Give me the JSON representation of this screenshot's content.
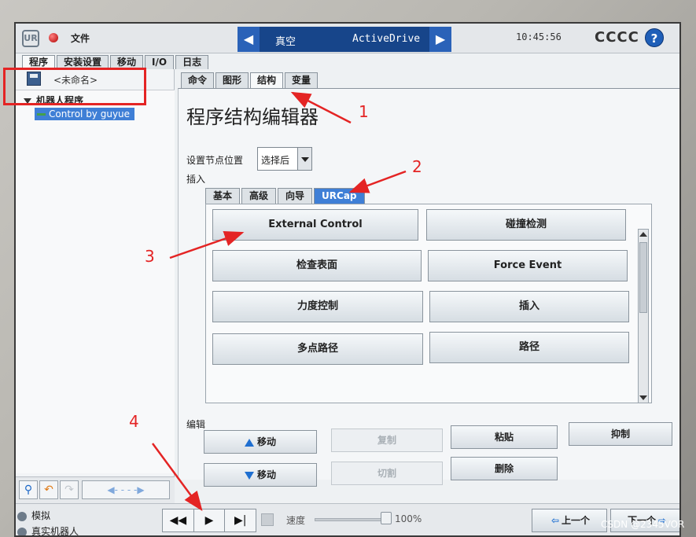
{
  "topbar": {
    "file_label": "文件",
    "mode_real": "真空",
    "mode_drive": "ActiveDrive",
    "clock": "10:45:56",
    "robot_name": "CCCC",
    "help": "?"
  },
  "main_tabs": [
    {
      "label": "程序"
    },
    {
      "label": "安装设置"
    },
    {
      "label": "移动"
    },
    {
      "label": "I/O"
    },
    {
      "label": "日志"
    }
  ],
  "left_panel": {
    "program_name": "<未命名>",
    "tree_root": "机器人程序",
    "tree_child": "Control by guyue"
  },
  "sub_tabs": [
    {
      "label": "命令"
    },
    {
      "label": "图形"
    },
    {
      "label": "结构"
    },
    {
      "label": "变量"
    }
  ],
  "editor": {
    "title": "程序结构编辑器",
    "node_position_label": "设置节点位置",
    "node_position_value": "选择后",
    "insert_label": "插入",
    "insert_tabs": [
      {
        "label": "基本"
      },
      {
        "label": "高级"
      },
      {
        "label": "向导"
      },
      {
        "label": "URCap"
      }
    ],
    "urcap_buttons": [
      "External Control",
      "碰撞检测",
      "检查表面",
      "Force Event",
      "力度控制",
      "插入",
      "多点路径",
      "路径"
    ],
    "edit_label": "编辑",
    "edit_buttons": {
      "move_up": "移动",
      "copy": "复制",
      "paste": "粘贴",
      "suppress": "抑制",
      "move_down": "移动",
      "cut": "切割",
      "delete": "删除"
    }
  },
  "bottombar": {
    "status_sim": "模拟",
    "status_real": "真实机器人",
    "speed_label": "速度",
    "speed_value": "100%",
    "speed_fraction": 1.0,
    "prev": "上一个",
    "next": "下一个"
  },
  "annotations": {
    "n1": "1",
    "n2": "2",
    "n3": "3",
    "n4": "4",
    "color": "#e42424"
  },
  "watermark": "CSDN @2345VOR",
  "colors": {
    "accent": "#3f7fd6",
    "mode_bar": "#17458a",
    "annotation": "#e42424"
  }
}
